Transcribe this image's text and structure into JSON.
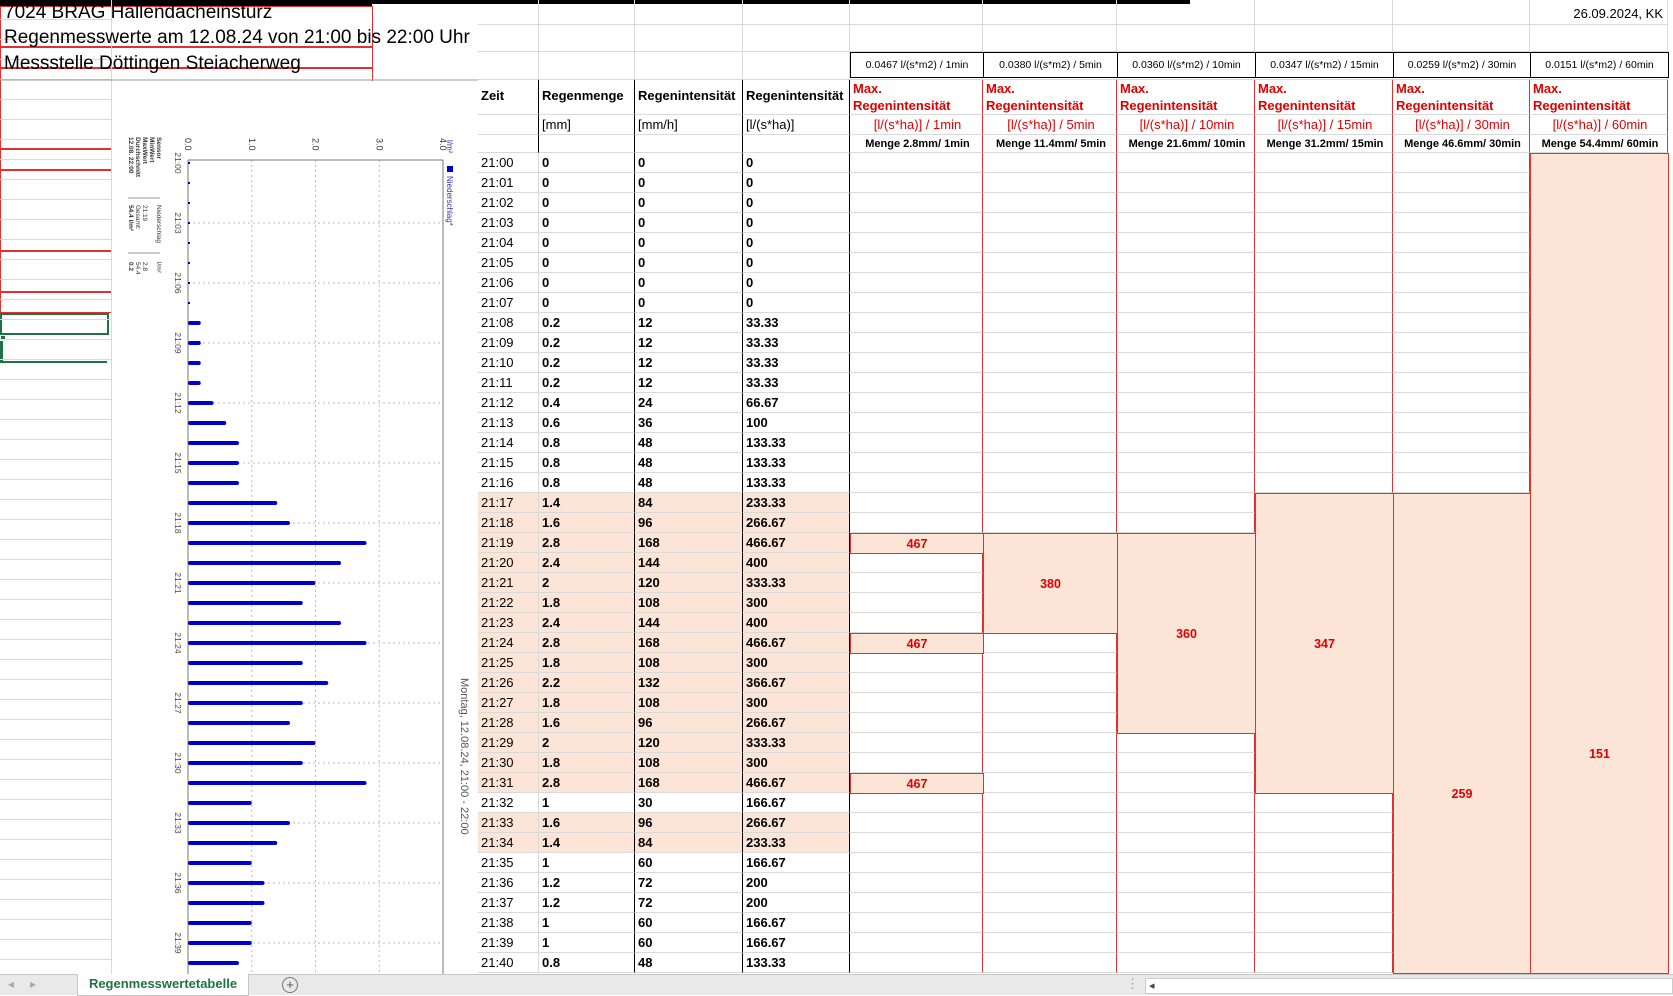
{
  "title": {
    "line1": "7024 BRAG Hallendacheinsturz",
    "line2": "Regenmesswerte am 12.08.24 von 21:00 bis 22:00 Uhr",
    "line3": "Messstelle Döttingen Steiacherweg",
    "date": "26.09.2024, KK"
  },
  "rates": [
    "0.0467 l/(s*m2) / 1min",
    "0.0380 l/(s*m2) / 5min",
    "0.0360 l/(s*m2) / 10min",
    "0.0347 l/(s*m2) / 15min",
    "0.0259 l/(s*m2) / 30min",
    "0.0151 l/(s*m2) / 60min"
  ],
  "headers": [
    {
      "label": "Zeit",
      "unit": ""
    },
    {
      "label": "Regenmenge",
      "unit": "[mm]"
    },
    {
      "label": "Regenintensität",
      "unit": "[mm/h]"
    },
    {
      "label": "Regenintensität",
      "unit": "[l/(s*ha)]"
    }
  ],
  "max_headers": [
    {
      "l1": "Max.",
      "l2": "Regenintensität",
      "unit": "[l/(s*ha)] / 1min",
      "menge": "Menge 2.8mm/ 1min"
    },
    {
      "l1": "Max.",
      "l2": "Regenintensität",
      "unit": "[l/(s*ha)] / 5min",
      "menge": "Menge 11.4mm/ 5min"
    },
    {
      "l1": "Max.",
      "l2": "Regenintensität",
      "unit": "[l/(s*ha)] / 10min",
      "menge": "Menge 21.6mm/ 10min"
    },
    {
      "l1": "Max.",
      "l2": "Regenintensität",
      "unit": "[l/(s*ha)] / 15min",
      "menge": "Menge 31.2mm/ 15min"
    },
    {
      "l1": "Max.",
      "l2": "Regenintensität",
      "unit": "[l/(s*ha)] / 30min",
      "menge": "Menge 46.6mm/ 30min"
    },
    {
      "l1": "Max.",
      "l2": "Regenintensität",
      "unit": "[l/(s*ha)] / 60min",
      "menge": "Menge 54.4mm/ 60min"
    }
  ],
  "rows": [
    [
      "21:00",
      "0",
      "0",
      "0"
    ],
    [
      "21:01",
      "0",
      "0",
      "0"
    ],
    [
      "21:02",
      "0",
      "0",
      "0"
    ],
    [
      "21:03",
      "0",
      "0",
      "0"
    ],
    [
      "21:04",
      "0",
      "0",
      "0"
    ],
    [
      "21:05",
      "0",
      "0",
      "0"
    ],
    [
      "21:06",
      "0",
      "0",
      "0"
    ],
    [
      "21:07",
      "0",
      "0",
      "0"
    ],
    [
      "21:08",
      "0.2",
      "12",
      "33.33"
    ],
    [
      "21:09",
      "0.2",
      "12",
      "33.33"
    ],
    [
      "21:10",
      "0.2",
      "12",
      "33.33"
    ],
    [
      "21:11",
      "0.2",
      "12",
      "33.33"
    ],
    [
      "21:12",
      "0.4",
      "24",
      "66.67"
    ],
    [
      "21:13",
      "0.6",
      "36",
      "100"
    ],
    [
      "21:14",
      "0.8",
      "48",
      "133.33"
    ],
    [
      "21:15",
      "0.8",
      "48",
      "133.33"
    ],
    [
      "21:16",
      "0.8",
      "48",
      "133.33"
    ],
    [
      "21:17",
      "1.4",
      "84",
      "233.33"
    ],
    [
      "21:18",
      "1.6",
      "96",
      "266.67"
    ],
    [
      "21:19",
      "2.8",
      "168",
      "466.67"
    ],
    [
      "21:20",
      "2.4",
      "144",
      "400"
    ],
    [
      "21:21",
      "2",
      "120",
      "333.33"
    ],
    [
      "21:22",
      "1.8",
      "108",
      "300"
    ],
    [
      "21:23",
      "2.4",
      "144",
      "400"
    ],
    [
      "21:24",
      "2.8",
      "168",
      "466.67"
    ],
    [
      "21:25",
      "1.8",
      "108",
      "300"
    ],
    [
      "21:26",
      "2.2",
      "132",
      "366.67"
    ],
    [
      "21:27",
      "1.8",
      "108",
      "300"
    ],
    [
      "21:28",
      "1.6",
      "96",
      "266.67"
    ],
    [
      "21:29",
      "2",
      "120",
      "333.33"
    ],
    [
      "21:30",
      "1.8",
      "108",
      "300"
    ],
    [
      "21:31",
      "2.8",
      "168",
      "466.67"
    ],
    [
      "21:32",
      "1",
      "30",
      "166.67"
    ],
    [
      "21:33",
      "1.6",
      "96",
      "266.67"
    ],
    [
      "21:34",
      "1.4",
      "84",
      "233.33"
    ],
    [
      "21:35",
      "1",
      "60",
      "166.67"
    ],
    [
      "21:36",
      "1.2",
      "72",
      "200"
    ],
    [
      "21:37",
      "1.2",
      "72",
      "200"
    ],
    [
      "21:38",
      "1",
      "60",
      "166.67"
    ],
    [
      "21:39",
      "1",
      "60",
      "166.67"
    ],
    [
      "21:40",
      "0.8",
      "48",
      "133.33"
    ]
  ],
  "highlight_groups": [
    [
      "21:17",
      "21:18"
    ],
    [
      "21:19",
      "21:19"
    ],
    [
      "21:20",
      "21:23"
    ],
    [
      "21:24",
      "21:24"
    ],
    [
      "21:25",
      "21:28"
    ],
    [
      "21:29",
      "21:30"
    ],
    [
      "21:31",
      "21:31"
    ]
  ],
  "highlight_plain": [
    [
      "21:33",
      "21:34"
    ]
  ],
  "max_blocks": [
    {
      "col": 0,
      "from": "21:19",
      "to": "21:19",
      "value": "467"
    },
    {
      "col": 0,
      "from": "21:24",
      "to": "21:24",
      "value": "467"
    },
    {
      "col": 0,
      "from": "21:31",
      "to": "21:31",
      "value": "467"
    },
    {
      "col": 1,
      "from": "21:19",
      "to": "21:23",
      "value": "380"
    },
    {
      "col": 2,
      "from": "21:19",
      "to": "21:28",
      "value": "360"
    },
    {
      "col": 3,
      "from": "21:17",
      "to": "21:31",
      "value": "347"
    },
    {
      "col": 4,
      "from": "21:17",
      "to": "21:46",
      "value": "259"
    },
    {
      "col": 5,
      "from": "21:00",
      "to": "21:59",
      "value": "151"
    }
  ],
  "selected_cell": "21:06",
  "chart_data": {
    "type": "bar",
    "orientation": "horizontal",
    "title": "Montag, 12.08.24, 21:00 - 22:00",
    "legend": "Niederschlag*",
    "unit": "l/m²",
    "xlim": [
      0,
      4
    ],
    "xticks": [
      "0.0",
      "1.0",
      "2.0",
      "3.0",
      "4.0"
    ],
    "time_ticks": [
      "21:00",
      "21:03",
      "21:06",
      "21:09",
      "21:12",
      "21:15",
      "21:18",
      "21:21",
      "21:24",
      "21:27",
      "21:30",
      "21:33",
      "21:36",
      "21:39"
    ],
    "categories": [
      "21:00",
      "21:01",
      "21:02",
      "21:03",
      "21:04",
      "21:05",
      "21:06",
      "21:07",
      "21:08",
      "21:09",
      "21:10",
      "21:11",
      "21:12",
      "21:13",
      "21:14",
      "21:15",
      "21:16",
      "21:17",
      "21:18",
      "21:19",
      "21:20",
      "21:21",
      "21:22",
      "21:23",
      "21:24",
      "21:25",
      "21:26",
      "21:27",
      "21:28",
      "21:29",
      "21:30",
      "21:31",
      "21:32",
      "21:33",
      "21:34",
      "21:35",
      "21:36",
      "21:37",
      "21:38",
      "21:39",
      "21:40"
    ],
    "values": [
      0,
      0,
      0,
      0,
      0,
      0,
      0,
      0,
      0.2,
      0.2,
      0.2,
      0.2,
      0.4,
      0.6,
      0.8,
      0.8,
      0.8,
      1.4,
      1.6,
      2.8,
      2.4,
      2,
      1.8,
      2.4,
      2.8,
      1.8,
      2.2,
      1.8,
      1.6,
      2,
      1.8,
      2.8,
      1,
      1.6,
      1.4,
      1,
      1.2,
      1.2,
      1,
      1,
      0.8
    ],
    "color": "#0000cc",
    "stats": {
      "labels": [
        "Sensor",
        "MinWert",
        "MaxWert",
        "Durchschnitt",
        "12.08. 22:00"
      ],
      "col2": [
        "Niederschlag",
        "",
        "21:19",
        "Gesamt:",
        "54.4 l/m²"
      ],
      "col3": [
        "l/m²",
        "",
        "2.8",
        "54.4",
        "0.2"
      ]
    }
  },
  "tabs": {
    "sheet": "Regenmesswertetabelle",
    "add": "+",
    "prev": "◂",
    "next": "▸",
    "more": "⋮",
    "scroll_left": "◂"
  }
}
